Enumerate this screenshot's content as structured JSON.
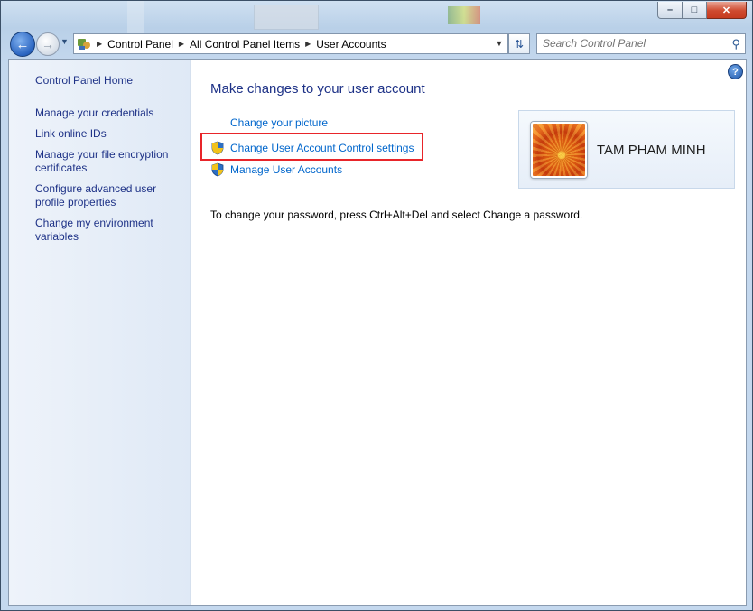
{
  "window": {
    "caption": {
      "minimize": "–",
      "maximize": "□",
      "close": "✕"
    }
  },
  "nav": {
    "back_icon": "back-arrow-icon",
    "forward_icon": "forward-arrow-icon",
    "breadcrumbs": [
      "Control Panel",
      "All Control Panel Items",
      "User Accounts"
    ],
    "search_placeholder": "Search Control Panel"
  },
  "sidebar": {
    "home": "Control Panel Home",
    "items": [
      "Manage your credentials",
      "Link online IDs",
      "Manage your file encryption certificates",
      "Configure advanced user profile properties",
      "Change my environment variables"
    ]
  },
  "main": {
    "title": "Make changes to your user account",
    "tasks": [
      {
        "label": "Change your picture",
        "shield": false
      },
      {
        "label": "Change User Account Control settings",
        "shield": true,
        "highlighted": true
      },
      {
        "label": "Manage User Accounts",
        "shield": true
      }
    ],
    "password_note": "To change your password, press Ctrl+Alt+Del and select Change a password.",
    "user_name": "TAM PHAM MINH"
  },
  "colors": {
    "link": "#0066cc",
    "nav_link": "#1e3287",
    "highlight_border": "#e8252a",
    "sidebar_bg": "#e6eef8"
  }
}
